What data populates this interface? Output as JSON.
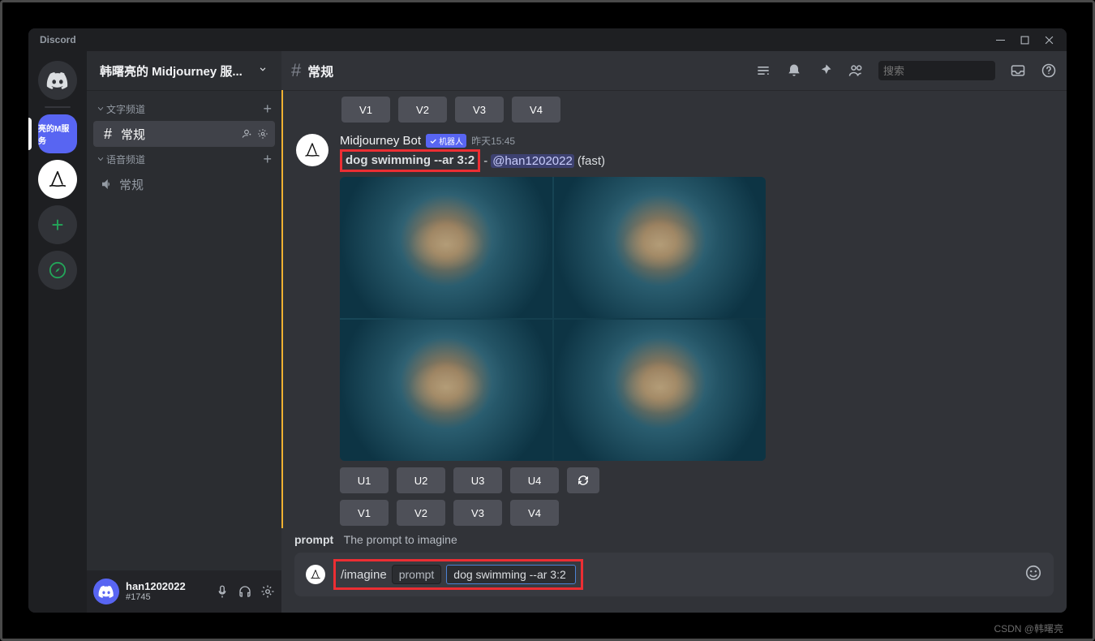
{
  "titlebar": {
    "app_name": "Discord"
  },
  "server_rail": {
    "selected_label": "亮的M服务",
    "add_tooltip": "添加服务器"
  },
  "sidebar": {
    "server_name": "韩曙亮的 Midjourney 服...",
    "categories": [
      {
        "name": "文字频道",
        "channels": [
          {
            "name": "常规",
            "icon": "hash",
            "active": true
          }
        ]
      },
      {
        "name": "语音频道",
        "channels": [
          {
            "name": "常规",
            "icon": "speaker",
            "active": false
          }
        ]
      }
    ]
  },
  "user_panel": {
    "username": "han1202022",
    "tag": "#1745"
  },
  "chat_header": {
    "channel_name": "常规",
    "search_placeholder": "搜索"
  },
  "messages": {
    "top_buttons": [
      "V1",
      "V2",
      "V3",
      "V4"
    ],
    "bot_name": "Midjourney Bot",
    "bot_badge": "机器人",
    "timestamp": "昨天15:45",
    "prompt_text": "dog swimming --ar 3:2",
    "mention": "@han1202022",
    "speed": "(fast)",
    "u_buttons": [
      "U1",
      "U2",
      "U3",
      "U4"
    ],
    "v_buttons": [
      "V1",
      "V2",
      "V3",
      "V4"
    ]
  },
  "composer": {
    "param_name": "prompt",
    "param_desc": "The prompt to imagine",
    "command": "/imagine",
    "pill": "prompt",
    "input_value": "dog swimming --ar 3:2"
  },
  "watermark": "CSDN @韩曙亮"
}
